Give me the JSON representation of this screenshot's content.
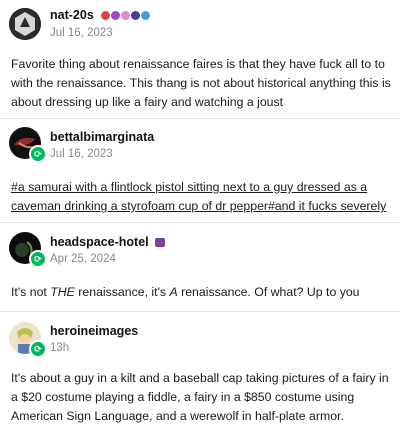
{
  "posts": [
    {
      "username": "nat-20s",
      "date": "Jul 16, 2023",
      "body": "Favorite thing about renaissance faires is that they have fuck all to to with the renaissance. This thang is not about historical anything this is about dressing up like a fairy and watching a joust"
    },
    {
      "username": "bettalbimarginata",
      "date": "Jul 16, 2023",
      "tags_line1": "#a samurai with a flintlock pistol sitting next to a guy dressed as a",
      "tags_line2": "caveman drinking a styrofoam cup of dr pepper#and it fucks severely"
    },
    {
      "username": "headspace-hotel",
      "date": "Apr 25, 2024",
      "body_pre": "It's not ",
      "body_em1": "THE",
      "body_mid": " renaissance, it's ",
      "body_em2": "A",
      "body_post": " renaissance. Of what? Up to you"
    },
    {
      "username": "heroineimages",
      "date": "13h",
      "body": "It's about a guy in a kilt and a baseball cap taking pictures of a fairy in a $20 costume playing a fiddle, a fairy in a $850 costume using American Sign Language, and a werewolf in half-plate armor."
    }
  ],
  "colors": {
    "reblog_green": "#00b85c",
    "muted": "#888888"
  }
}
